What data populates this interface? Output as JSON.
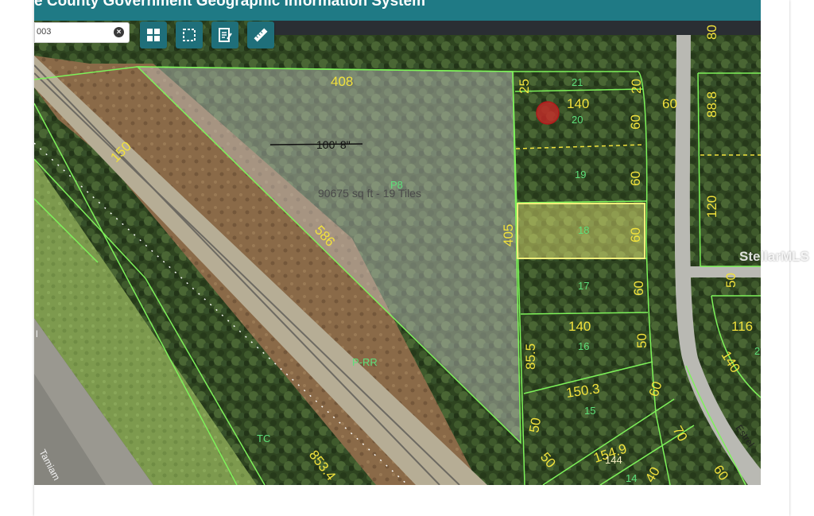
{
  "header": {
    "title": "e County Government Geographic Information System"
  },
  "search": {
    "value": "003"
  },
  "toolbar": {
    "icons": [
      "grid-icon",
      "select-area-icon",
      "notepad-icon",
      "ruler-icon"
    ]
  },
  "map": {
    "measurement_line": "100' 8\"",
    "area_label": "90675 sq ft - 19 Tiles",
    "zones": [
      "P8",
      "P-RR",
      "TC"
    ],
    "dimensions": {
      "d408": "408",
      "d150_diag": "150",
      "d586": "586",
      "d405": "405",
      "d25": "25",
      "d20_top": "20",
      "d140_a": "140",
      "d60_a": "60",
      "d60_b": "60",
      "d60_c": "60",
      "d60_d": "60",
      "d60_street": "60",
      "d140_b": "140",
      "d50_a": "50",
      "d85_5": "85.5",
      "d150_3": "150.3",
      "d60_e": "60",
      "d50_b": "50",
      "d50_c": "50",
      "d70": "70",
      "d154_9": "154.9",
      "d60_f": "60",
      "d40": "40",
      "d853_4": "853.4",
      "d88_8": "88.8",
      "d80": "80",
      "d120": "120",
      "d50_d": "50",
      "d116": "116",
      "d140_c": "140"
    },
    "lots": {
      "l21": "21",
      "l20": "20",
      "l19": "19",
      "l18": "18",
      "l17": "17",
      "l16": "16",
      "l15": "15",
      "l144": "144",
      "l14": "14",
      "l2": "2"
    },
    "streets": {
      "estrella": "Estrel",
      "tamiami": "Tamiam",
      "partial_l": "l"
    }
  },
  "watermark": "StellarMLS",
  "colors": {
    "header": "#1f7a85",
    "toolbar_button": "#1f6f7a",
    "parcel_line": "#7ef25a",
    "dimension_text": "#f2e23c",
    "lot_text": "#5ee07a",
    "selected_lot": "#f0ee7a",
    "marker": "#d02828"
  }
}
